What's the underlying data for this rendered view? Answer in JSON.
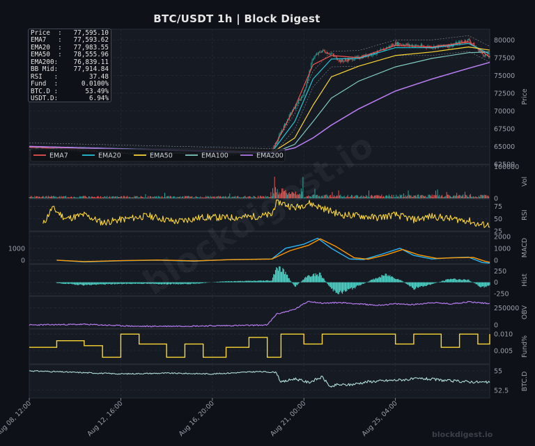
{
  "header": {
    "title": "BTC/USDT  1h  |  Block Digest"
  },
  "info_box": [
    {
      "label": "Price  :",
      "value": "77,595.10"
    },
    {
      "label": "EMA7   :",
      "value": "77,593.62"
    },
    {
      "label": "EMA20  :",
      "value": "77,983.55"
    },
    {
      "label": "EMA50  :",
      "value": "78,555.96"
    },
    {
      "label": "EMA200:",
      "value": "76,839.11"
    },
    {
      "label": "BB Mid:",
      "value": "77,914.84"
    },
    {
      "label": "RSI   :",
      "value": "37.48"
    },
    {
      "label": "Fund  :",
      "value": "0.0100%"
    },
    {
      "label": "BTC.D :",
      "value": "53.49%"
    },
    {
      "label": "USDT.D:",
      "value": "6.94%"
    }
  ],
  "watermark_overlay": "blockdigest.io",
  "footer": {
    "brand": "blockdigest.io"
  },
  "colors": {
    "background": "#0e1117",
    "panel": "#161a22",
    "grid": "#2a2f38",
    "axis_text": "#9aa0a8",
    "up": "#26a69a",
    "down": "#ef5350",
    "ema7": "#ef5350",
    "ema20": "#26c6da",
    "ema50": "#fdd835",
    "ema100": "#80cbc4",
    "ema200": "#b57bee",
    "rsi": "#fdd835",
    "macd": "#29b6f6",
    "signal": "#ff9800",
    "hist": "#4dd0c4",
    "obv": "#b57bee",
    "fund": "#fdd835",
    "btcd": "#b2dfdb"
  },
  "chart_data": {
    "type": "line",
    "x_ticks": [
      "Aug 08, 12:00",
      "Aug 12, 16:00",
      "Aug 16, 20:00",
      "Aug 21, 00:00",
      "Aug 25, 04:00"
    ],
    "x_tick_bars": [
      0,
      100,
      200,
      300,
      400
    ],
    "bars_total": 503,
    "price": {
      "ylabel": "Price",
      "ylim": [
        62500,
        81500
      ],
      "yticks": [
        62500,
        65000,
        67500,
        70000,
        72500,
        75000,
        77500,
        80000
      ],
      "close": [
        {
          "x": 0,
          "y": 64900
        },
        {
          "x": 40,
          "y": 64600
        },
        {
          "x": 80,
          "y": 64300
        },
        {
          "x": 120,
          "y": 63900
        },
        {
          "x": 160,
          "y": 64100
        },
        {
          "x": 200,
          "y": 64000
        },
        {
          "x": 240,
          "y": 64100
        },
        {
          "x": 265,
          "y": 64300
        },
        {
          "x": 275,
          "y": 67000
        },
        {
          "x": 285,
          "y": 69500
        },
        {
          "x": 300,
          "y": 72500
        },
        {
          "x": 310,
          "y": 77500
        },
        {
          "x": 320,
          "y": 78500
        },
        {
          "x": 330,
          "y": 78000
        },
        {
          "x": 340,
          "y": 77000
        },
        {
          "x": 360,
          "y": 77500
        },
        {
          "x": 380,
          "y": 78200
        },
        {
          "x": 400,
          "y": 79500
        },
        {
          "x": 420,
          "y": 79200
        },
        {
          "x": 440,
          "y": 79000
        },
        {
          "x": 460,
          "y": 79200
        },
        {
          "x": 480,
          "y": 80000
        },
        {
          "x": 495,
          "y": 78000
        },
        {
          "x": 503,
          "y": 77595
        }
      ],
      "ema": [
        {
          "name": "EMA7",
          "values": [
            {
              "x": 0,
              "y": 64900
            },
            {
              "x": 265,
              "y": 64300
            },
            {
              "x": 290,
              "y": 70500
            },
            {
              "x": 310,
              "y": 76500
            },
            {
              "x": 330,
              "y": 77800
            },
            {
              "x": 360,
              "y": 77500
            },
            {
              "x": 400,
              "y": 79200
            },
            {
              "x": 440,
              "y": 79000
            },
            {
              "x": 480,
              "y": 79700
            },
            {
              "x": 503,
              "y": 77594
            }
          ]
        },
        {
          "name": "EMA20",
          "values": [
            {
              "x": 0,
              "y": 65000
            },
            {
              "x": 265,
              "y": 64200
            },
            {
              "x": 290,
              "y": 68500
            },
            {
              "x": 310,
              "y": 74500
            },
            {
              "x": 330,
              "y": 77300
            },
            {
              "x": 360,
              "y": 77400
            },
            {
              "x": 400,
              "y": 78900
            },
            {
              "x": 440,
              "y": 78900
            },
            {
              "x": 480,
              "y": 79500
            },
            {
              "x": 503,
              "y": 77984
            }
          ]
        },
        {
          "name": "EMA50",
          "values": [
            {
              "x": 0,
              "y": 65000
            },
            {
              "x": 265,
              "y": 64100
            },
            {
              "x": 290,
              "y": 66200
            },
            {
              "x": 310,
              "y": 70800
            },
            {
              "x": 330,
              "y": 74800
            },
            {
              "x": 360,
              "y": 76300
            },
            {
              "x": 400,
              "y": 77800
            },
            {
              "x": 440,
              "y": 78300
            },
            {
              "x": 480,
              "y": 79000
            },
            {
              "x": 503,
              "y": 78556
            }
          ]
        },
        {
          "name": "EMA100",
          "values": [
            {
              "x": 0,
              "y": 65000
            },
            {
              "x": 265,
              "y": 64000
            },
            {
              "x": 290,
              "y": 65300
            },
            {
              "x": 310,
              "y": 68500
            },
            {
              "x": 330,
              "y": 71800
            },
            {
              "x": 360,
              "y": 74200
            },
            {
              "x": 400,
              "y": 76200
            },
            {
              "x": 440,
              "y": 77400
            },
            {
              "x": 480,
              "y": 78200
            },
            {
              "x": 503,
              "y": 78300
            }
          ]
        },
        {
          "name": "EMA200",
          "values": [
            {
              "x": 0,
              "y": 65000
            },
            {
              "x": 265,
              "y": 64100
            },
            {
              "x": 290,
              "y": 64800
            },
            {
              "x": 310,
              "y": 66200
            },
            {
              "x": 330,
              "y": 68000
            },
            {
              "x": 360,
              "y": 70300
            },
            {
              "x": 400,
              "y": 72800
            },
            {
              "x": 440,
              "y": 74500
            },
            {
              "x": 480,
              "y": 76000
            },
            {
              "x": 503,
              "y": 76839
            }
          ]
        }
      ]
    },
    "volume": {
      "ylabel": "Vol",
      "ylim": [
        0,
        105000
      ],
      "yticks": [
        0,
        100000
      ],
      "peak": {
        "x": 268,
        "y": 68000
      }
    },
    "rsi": {
      "ylabel": "RSI",
      "ylim": [
        25,
        90
      ],
      "yticks": [
        25,
        50,
        75
      ],
      "values": [
        {
          "x": 15,
          "y": 38
        },
        {
          "x": 25,
          "y": 72
        },
        {
          "x": 40,
          "y": 50
        },
        {
          "x": 60,
          "y": 58
        },
        {
          "x": 80,
          "y": 42
        },
        {
          "x": 100,
          "y": 48
        },
        {
          "x": 130,
          "y": 56
        },
        {
          "x": 160,
          "y": 44
        },
        {
          "x": 190,
          "y": 53
        },
        {
          "x": 220,
          "y": 52
        },
        {
          "x": 250,
          "y": 55
        },
        {
          "x": 265,
          "y": 58
        },
        {
          "x": 270,
          "y": 86
        },
        {
          "x": 290,
          "y": 72
        },
        {
          "x": 305,
          "y": 82
        },
        {
          "x": 320,
          "y": 72
        },
        {
          "x": 340,
          "y": 58
        },
        {
          "x": 360,
          "y": 56
        },
        {
          "x": 380,
          "y": 52
        },
        {
          "x": 400,
          "y": 58
        },
        {
          "x": 420,
          "y": 48
        },
        {
          "x": 440,
          "y": 55
        },
        {
          "x": 460,
          "y": 50
        },
        {
          "x": 480,
          "y": 46
        },
        {
          "x": 490,
          "y": 38
        },
        {
          "x": 503,
          "y": 37.48
        }
      ]
    },
    "macd": {
      "ylabel": "MACD",
      "ylim": [
        -300,
        2400
      ],
      "yticks": [
        0,
        1000,
        2000
      ],
      "macd": [
        {
          "x": 30,
          "y": 0
        },
        {
          "x": 60,
          "y": -150
        },
        {
          "x": 100,
          "y": -50
        },
        {
          "x": 140,
          "y": 0
        },
        {
          "x": 180,
          "y": -80
        },
        {
          "x": 220,
          "y": 50
        },
        {
          "x": 265,
          "y": 100
        },
        {
          "x": 280,
          "y": 1000
        },
        {
          "x": 300,
          "y": 1350
        },
        {
          "x": 315,
          "y": 1850
        },
        {
          "x": 330,
          "y": 1000
        },
        {
          "x": 350,
          "y": 100
        },
        {
          "x": 365,
          "y": 50
        },
        {
          "x": 385,
          "y": 500
        },
        {
          "x": 405,
          "y": 1000
        },
        {
          "x": 420,
          "y": 400
        },
        {
          "x": 440,
          "y": 100
        },
        {
          "x": 460,
          "y": 200
        },
        {
          "x": 480,
          "y": 250
        },
        {
          "x": 495,
          "y": -200
        },
        {
          "x": 503,
          "y": -250
        }
      ],
      "signal": [
        {
          "x": 30,
          "y": 0
        },
        {
          "x": 60,
          "y": -120
        },
        {
          "x": 100,
          "y": -40
        },
        {
          "x": 140,
          "y": 10
        },
        {
          "x": 180,
          "y": -60
        },
        {
          "x": 220,
          "y": 40
        },
        {
          "x": 265,
          "y": 90
        },
        {
          "x": 285,
          "y": 800
        },
        {
          "x": 305,
          "y": 1250
        },
        {
          "x": 318,
          "y": 1800
        },
        {
          "x": 335,
          "y": 1150
        },
        {
          "x": 355,
          "y": 200
        },
        {
          "x": 370,
          "y": 80
        },
        {
          "x": 390,
          "y": 450
        },
        {
          "x": 408,
          "y": 900
        },
        {
          "x": 425,
          "y": 450
        },
        {
          "x": 445,
          "y": 150
        },
        {
          "x": 465,
          "y": 200
        },
        {
          "x": 485,
          "y": 230
        },
        {
          "x": 498,
          "y": -100
        },
        {
          "x": 503,
          "y": -180
        }
      ]
    },
    "hist": {
      "ylabel": "Hist",
      "ylim": [
        -300,
        400
      ],
      "yticks": [
        -250,
        0,
        250
      ],
      "values": [
        {
          "x": 30,
          "y": -20
        },
        {
          "x": 60,
          "y": -60
        },
        {
          "x": 90,
          "y": -40
        },
        {
          "x": 120,
          "y": -30
        },
        {
          "x": 150,
          "y": -40
        },
        {
          "x": 180,
          "y": -35
        },
        {
          "x": 210,
          "y": 20
        },
        {
          "x": 240,
          "y": 30
        },
        {
          "x": 265,
          "y": 40
        },
        {
          "x": 270,
          "y": 350
        },
        {
          "x": 278,
          "y": 260
        },
        {
          "x": 290,
          "y": -100
        },
        {
          "x": 305,
          "y": 150
        },
        {
          "x": 318,
          "y": 180
        },
        {
          "x": 330,
          "y": -150
        },
        {
          "x": 340,
          "y": -240
        },
        {
          "x": 355,
          "y": -120
        },
        {
          "x": 375,
          "y": 60
        },
        {
          "x": 390,
          "y": 170
        },
        {
          "x": 405,
          "y": 60
        },
        {
          "x": 420,
          "y": -140
        },
        {
          "x": 440,
          "y": -40
        },
        {
          "x": 460,
          "y": 80
        },
        {
          "x": 480,
          "y": 50
        },
        {
          "x": 495,
          "y": -120
        },
        {
          "x": 503,
          "y": -60
        }
      ]
    },
    "obv": {
      "ylabel": "OBV",
      "ylim": [
        -50000,
        420000
      ],
      "yticks": [
        0,
        250000
      ],
      "values": [
        {
          "x": 0,
          "y": 0
        },
        {
          "x": 60,
          "y": 10000
        },
        {
          "x": 120,
          "y": -20000
        },
        {
          "x": 180,
          "y": -15000
        },
        {
          "x": 240,
          "y": -5000
        },
        {
          "x": 260,
          "y": 0
        },
        {
          "x": 270,
          "y": 160000
        },
        {
          "x": 290,
          "y": 230000
        },
        {
          "x": 305,
          "y": 350000
        },
        {
          "x": 320,
          "y": 320000
        },
        {
          "x": 340,
          "y": 330000
        },
        {
          "x": 360,
          "y": 310000
        },
        {
          "x": 380,
          "y": 290000
        },
        {
          "x": 400,
          "y": 310000
        },
        {
          "x": 420,
          "y": 300000
        },
        {
          "x": 440,
          "y": 330000
        },
        {
          "x": 460,
          "y": 310000
        },
        {
          "x": 480,
          "y": 340000
        },
        {
          "x": 503,
          "y": 315000
        }
      ]
    },
    "fund": {
      "ylabel": "Fund%",
      "ylim": [
        0.001,
        0.0115
      ],
      "yticks": [
        0.005,
        0.01
      ],
      "values": [
        {
          "x": 0,
          "y": 0.006
        },
        {
          "x": 30,
          "y": 0.008
        },
        {
          "x": 60,
          "y": 0.0065
        },
        {
          "x": 80,
          "y": 0.003
        },
        {
          "x": 100,
          "y": 0.01
        },
        {
          "x": 120,
          "y": 0.007
        },
        {
          "x": 150,
          "y": 0.003
        },
        {
          "x": 170,
          "y": 0.007
        },
        {
          "x": 190,
          "y": 0.003
        },
        {
          "x": 215,
          "y": 0.006
        },
        {
          "x": 240,
          "y": 0.009
        },
        {
          "x": 260,
          "y": 0.003
        },
        {
          "x": 275,
          "y": 0.01
        },
        {
          "x": 300,
          "y": 0.007
        },
        {
          "x": 320,
          "y": 0.01
        },
        {
          "x": 400,
          "y": 0.007
        },
        {
          "x": 420,
          "y": 0.01
        },
        {
          "x": 450,
          "y": 0.006
        },
        {
          "x": 470,
          "y": 0.01
        },
        {
          "x": 490,
          "y": 0.007
        },
        {
          "x": 503,
          "y": 0.01
        }
      ]
    },
    "btcd": {
      "ylabel": "BTC.D",
      "ylim": [
        51.5,
        55.8
      ],
      "yticks": [
        52.5,
        55.0
      ],
      "values": [
        {
          "x": 0,
          "y": 55.0
        },
        {
          "x": 50,
          "y": 54.8
        },
        {
          "x": 100,
          "y": 54.6
        },
        {
          "x": 150,
          "y": 54.7
        },
        {
          "x": 200,
          "y": 54.6
        },
        {
          "x": 250,
          "y": 54.9
        },
        {
          "x": 270,
          "y": 54.8
        },
        {
          "x": 275,
          "y": 53.5
        },
        {
          "x": 290,
          "y": 54.0
        },
        {
          "x": 305,
          "y": 53.5
        },
        {
          "x": 320,
          "y": 54.2
        },
        {
          "x": 330,
          "y": 52.8
        },
        {
          "x": 335,
          "y": 53.2
        },
        {
          "x": 350,
          "y": 53.2
        },
        {
          "x": 370,
          "y": 53.6
        },
        {
          "x": 400,
          "y": 53.8
        },
        {
          "x": 430,
          "y": 54.0
        },
        {
          "x": 460,
          "y": 53.7
        },
        {
          "x": 480,
          "y": 53.6
        },
        {
          "x": 503,
          "y": 53.49
        }
      ]
    }
  }
}
